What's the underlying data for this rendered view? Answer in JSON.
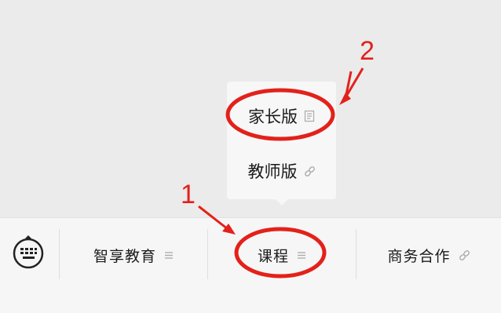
{
  "popup_menu": {
    "items": [
      {
        "label": "家长版",
        "icon": "document-icon"
      },
      {
        "label": "教师版",
        "icon": "link-icon"
      }
    ]
  },
  "bottom_menu": {
    "keyboard_icon": "keyboard-icon",
    "tabs": [
      {
        "label": "智享教育",
        "icon": "menu-lines-icon"
      },
      {
        "label": "课程",
        "icon": "menu-lines-icon"
      },
      {
        "label": "商务合作",
        "icon": "link-icon"
      }
    ]
  },
  "annotations": {
    "marker_1": "1",
    "marker_2": "2",
    "color": "#e3211a"
  }
}
